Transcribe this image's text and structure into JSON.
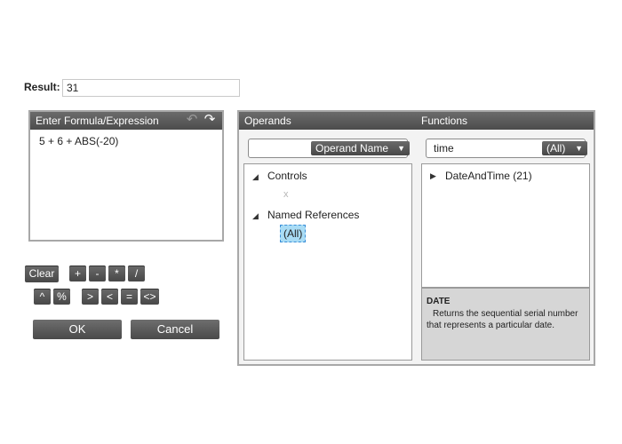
{
  "result": {
    "label": "Result:",
    "value": "31"
  },
  "formula_panel": {
    "title": "Enter Formula/Expression",
    "expression": "5 + 6 + ABS(-20)"
  },
  "operators": {
    "clear": "Clear",
    "row1": [
      "+",
      "-",
      "*",
      "/"
    ],
    "row2a": [
      "^",
      "%"
    ],
    "row2b": [
      ">",
      "<",
      "=",
      "<>"
    ]
  },
  "actions": {
    "ok": "OK",
    "cancel": "Cancel"
  },
  "operands": {
    "title": "Operands",
    "filter_value": "",
    "dropdown_label": "Operand Name",
    "tree": {
      "controls": "Controls",
      "controls_child": "x",
      "named_refs": "Named References",
      "named_child": "(All)"
    }
  },
  "functions": {
    "title": "Functions",
    "search_value": "time",
    "dropdown_label": "(All)",
    "category": "DateAndTime (21)",
    "desc_title": "DATE",
    "desc_line1": "Returns the sequential serial number",
    "desc_line2": "that represents a particular date."
  }
}
